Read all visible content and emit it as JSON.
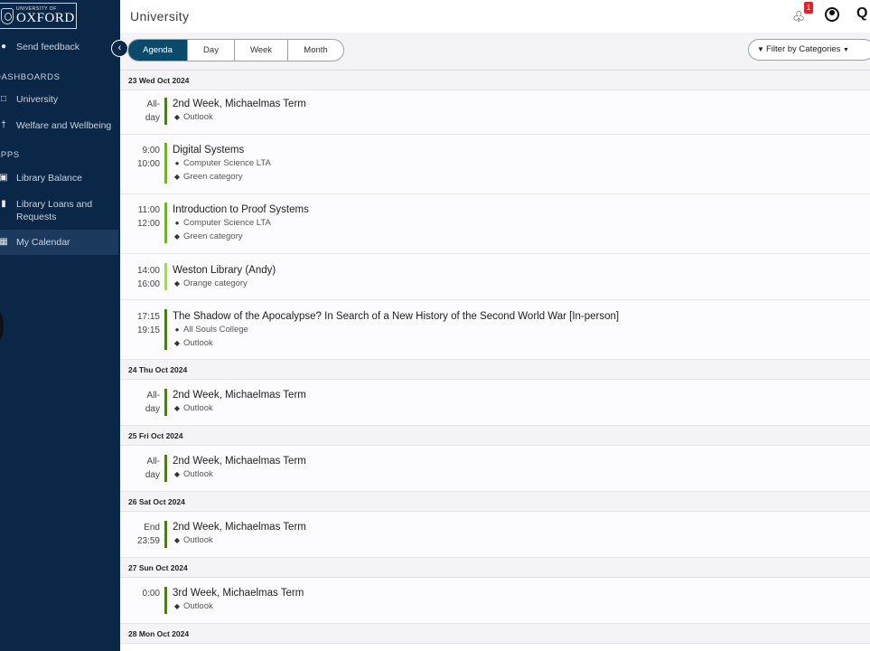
{
  "sidebar": {
    "logo_small": "UNIVERSITY OF",
    "logo_big": "OXFORD",
    "feedback": "Send feedback",
    "dashboards_heading": "DASHBOARDS",
    "university": "University",
    "welfare": "Welfare and Wellbeing",
    "apps_heading": "APPS",
    "library_balance": "Library Balance",
    "library_loans_line1": "Library Loans and",
    "library_loans_line2": "Requests",
    "my_calendar": "My Calendar"
  },
  "topbar": {
    "title": "University",
    "notification_count": "1"
  },
  "toolbar": {
    "views": [
      "Agenda",
      "Day",
      "Week",
      "Month"
    ],
    "active_view": "Agenda",
    "filter_label": "Filter by Categories"
  },
  "colors": {
    "sidebar_bg": "#0b2747",
    "active_tab": "#0b4a6b",
    "outlook": "#4f7a1e",
    "green_category": "#74b12e",
    "orange_category": "#a7d36a",
    "badge": "#e0232b"
  },
  "agenda": {
    "days": [
      {
        "date": "23 Wed Oct 2024",
        "events": [
          {
            "time1": "All-",
            "time2": "day",
            "title": "2nd Week, Michaelmas Term",
            "location": "",
            "category": "Outlook"
          },
          {
            "time1": "9:00",
            "time2": "10:00",
            "title": "Digital Systems",
            "location": "Computer Science LTA",
            "category": "Green category"
          },
          {
            "time1": "11:00",
            "time2": "12:00",
            "title": "Introduction to Proof Systems",
            "location": "Computer Science LTA",
            "category": "Green category"
          },
          {
            "time1": "14:00",
            "time2": "16:00",
            "title": "Weston Library (Andy)",
            "location": "",
            "category": "Orange category"
          },
          {
            "time1": "17:15",
            "time2": "19:15",
            "title": "The Shadow of the Apocalypse? In Search of a New History of the Second World War [In-person]",
            "location": "All Souls College",
            "category": "Outlook"
          }
        ]
      },
      {
        "date": "24 Thu Oct 2024",
        "events": [
          {
            "time1": "All-",
            "time2": "day",
            "title": "2nd Week, Michaelmas Term",
            "location": "",
            "category": "Outlook"
          }
        ]
      },
      {
        "date": "25 Fri Oct 2024",
        "events": [
          {
            "time1": "All-",
            "time2": "day",
            "title": "2nd Week, Michaelmas Term",
            "location": "",
            "category": "Outlook"
          }
        ]
      },
      {
        "date": "26 Sat Oct 2024",
        "events": [
          {
            "time1": "End",
            "time2": "23:59",
            "title": "2nd Week, Michaelmas Term",
            "location": "",
            "category": "Outlook"
          }
        ]
      },
      {
        "date": "27 Sun Oct 2024",
        "events": [
          {
            "time1": "0:00",
            "time2": "",
            "title": "3rd Week, Michaelmas Term",
            "location": "",
            "category": "Outlook"
          }
        ]
      },
      {
        "date": "28 Mon Oct 2024",
        "events": []
      }
    ]
  }
}
